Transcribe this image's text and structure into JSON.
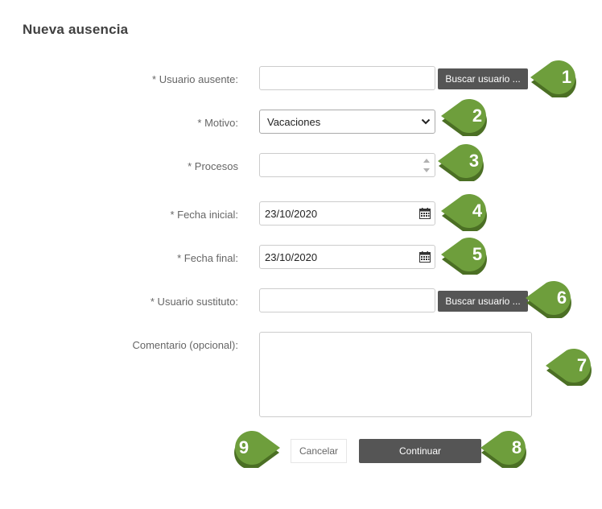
{
  "page": {
    "title": "Nueva ausencia"
  },
  "form": {
    "usuario_ausente": {
      "label": "* Usuario ausente:",
      "value": "",
      "button": "Buscar usuario ..."
    },
    "motivo": {
      "label": "* Motivo:",
      "value": "Vacaciones"
    },
    "procesos": {
      "label": "* Procesos",
      "value": ""
    },
    "fecha_inicial": {
      "label": "* Fecha inicial:",
      "value": "23/10/2020"
    },
    "fecha_final": {
      "label": "* Fecha final:",
      "value": "23/10/2020"
    },
    "usuario_sustituto": {
      "label": "* Usuario sustituto:",
      "value": "",
      "button": "Buscar usuario ..."
    },
    "comentario": {
      "label": "Comentario (opcional):",
      "value": ""
    }
  },
  "actions": {
    "cancel": "Cancelar",
    "continue": "Continuar"
  },
  "callouts": [
    "1",
    "2",
    "3",
    "4",
    "5",
    "6",
    "7",
    "8",
    "9"
  ],
  "colors": {
    "callout": "#6e9e3c",
    "dark_button": "#555555"
  }
}
